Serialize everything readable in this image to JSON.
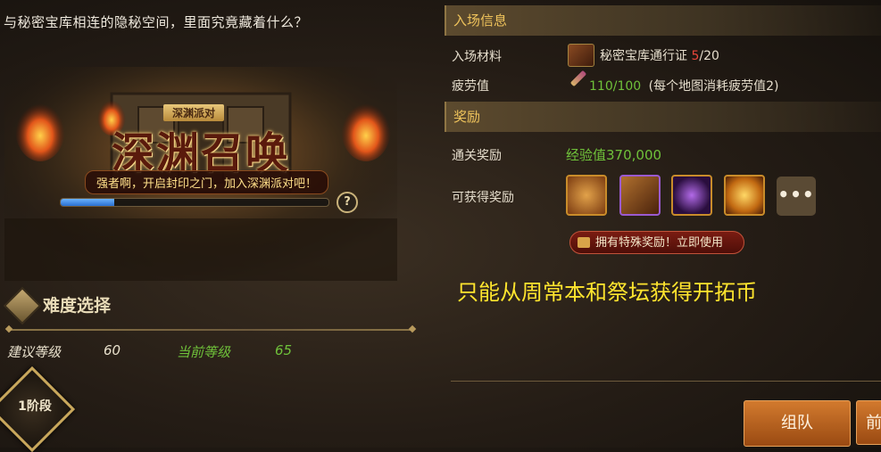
{
  "header": {
    "description": "与秘密宝库相连的隐秘空间，里面究竟藏着什么？"
  },
  "banner": {
    "small_title": "深渊派对",
    "title": "深渊召唤",
    "subtitle": "强者啊，开启封印之门，加入深渊派对吧！",
    "progress_fraction": 0.2,
    "help_glyph": "?"
  },
  "difficulty": {
    "label": "难度选择",
    "recommended_label": "建议等级",
    "recommended_value": "60",
    "current_label": "当前等级",
    "current_value": "65",
    "stage_label": "1阶段"
  },
  "entry_info": {
    "header": "入场信息",
    "material_label": "入场材料",
    "material_name": "秘密宝库通行证",
    "material_count": "5",
    "material_total": "/20",
    "fatigue_label": "疲劳值",
    "fatigue_value": "110/100",
    "fatigue_note": "(每个地图消耗疲劳值2)"
  },
  "rewards": {
    "header": "奖励",
    "clear_label": "通关奖励",
    "clear_value": "经验值370,000",
    "obtainable_label": "可获得奖励",
    "more_glyph": "•••",
    "icons": [
      "mask-icon",
      "chest-icon",
      "purple-crystal-icon",
      "golden-orb-icon"
    ],
    "special_button": "拥有特殊奖励！立即使用"
  },
  "overlay_note": "只能从周常本和祭坛获得开拓币",
  "actions": {
    "team_button": "组队",
    "next_button": "前"
  },
  "colors": {
    "accent_gold": "#f0c45c",
    "progress_blue": "#3f8ae8",
    "note_yellow": "#ffe52e",
    "count_red": "#e8463a",
    "exp_green": "#6fc13a"
  }
}
